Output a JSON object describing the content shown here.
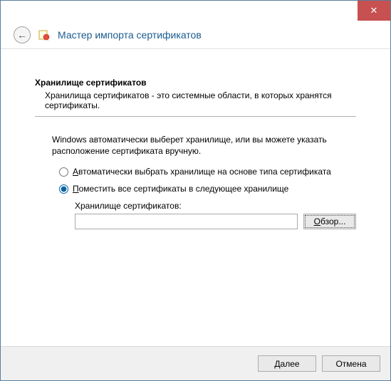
{
  "titlebar": {
    "close_glyph": "✕"
  },
  "header": {
    "back_glyph": "←",
    "title": "Мастер импорта сертификатов"
  },
  "section": {
    "title": "Хранилище сертификатов",
    "description": "Хранилища сертификатов - это системные области, в которых хранятся сертификаты."
  },
  "body": {
    "intro": "Windows автоматически выберет хранилище, или вы можете указать расположение сертификата вручную."
  },
  "radios": {
    "auto": {
      "prefix": "А",
      "rest": "втоматически выбрать хранилище на основе типа сертификата",
      "checked": false
    },
    "manual": {
      "prefix": "П",
      "rest": "оместить все сертификаты в следующее хранилище",
      "checked": true
    }
  },
  "store": {
    "label": "Хранилище сертификатов:",
    "value": "",
    "browse_prefix": "О",
    "browse_rest": "бзор..."
  },
  "footer": {
    "next_prefix": "Д",
    "next_rest": "алее",
    "cancel": "Отмена"
  }
}
